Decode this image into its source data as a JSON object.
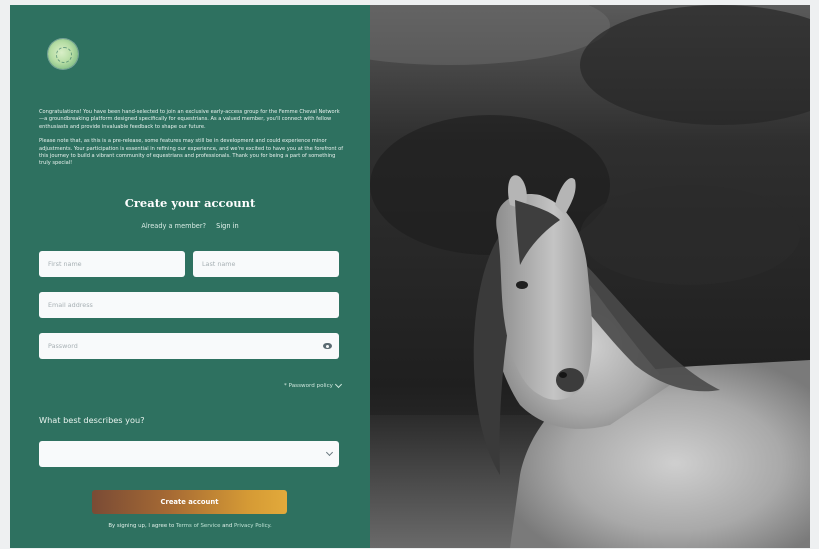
{
  "intro": {
    "paragraph1": "Congratulations! You have been hand-selected to join an exclusive early-access group for the Femme Cheval Network—a groundbreaking platform designed specifically for equestrians. As a valued member, you'll connect with fellow enthusiasts and provide invaluable feedback to shape our future.",
    "paragraph2": "Please note that, as this is a pre-release, some features may still be in development and could experience minor adjustments. Your participation is essential in refining our experience, and we're excited to have you at the forefront of this journey to build a vibrant community of equestrians and professionals. Thank you for being a part of something truly special!"
  },
  "form": {
    "title": "Create your account",
    "already_member": "Already a member?",
    "sign_in": "Sign in",
    "first_name_placeholder": "First name",
    "last_name_placeholder": "Last name",
    "email_placeholder": "Email address",
    "password_placeholder": "Password",
    "password_policy": "* Password policy",
    "describe_question": "What best describes you?",
    "describe_selected": "",
    "submit_label": "Create account",
    "terms_prefix": "By signing up, I agree to ",
    "terms_link": "Terms of Service",
    "terms_and": " and ",
    "privacy_link": "Privacy Policy",
    "terms_suffix": "."
  },
  "icons": {
    "logo": "brand-logo-icon",
    "password_toggle": "eye-icon",
    "policy_expand": "chevron-down-icon",
    "select_expand": "chevron-down-icon"
  },
  "colors": {
    "panel": "#2e7160",
    "button_start": "#7a4b35",
    "button_end": "#e2aa3b"
  }
}
